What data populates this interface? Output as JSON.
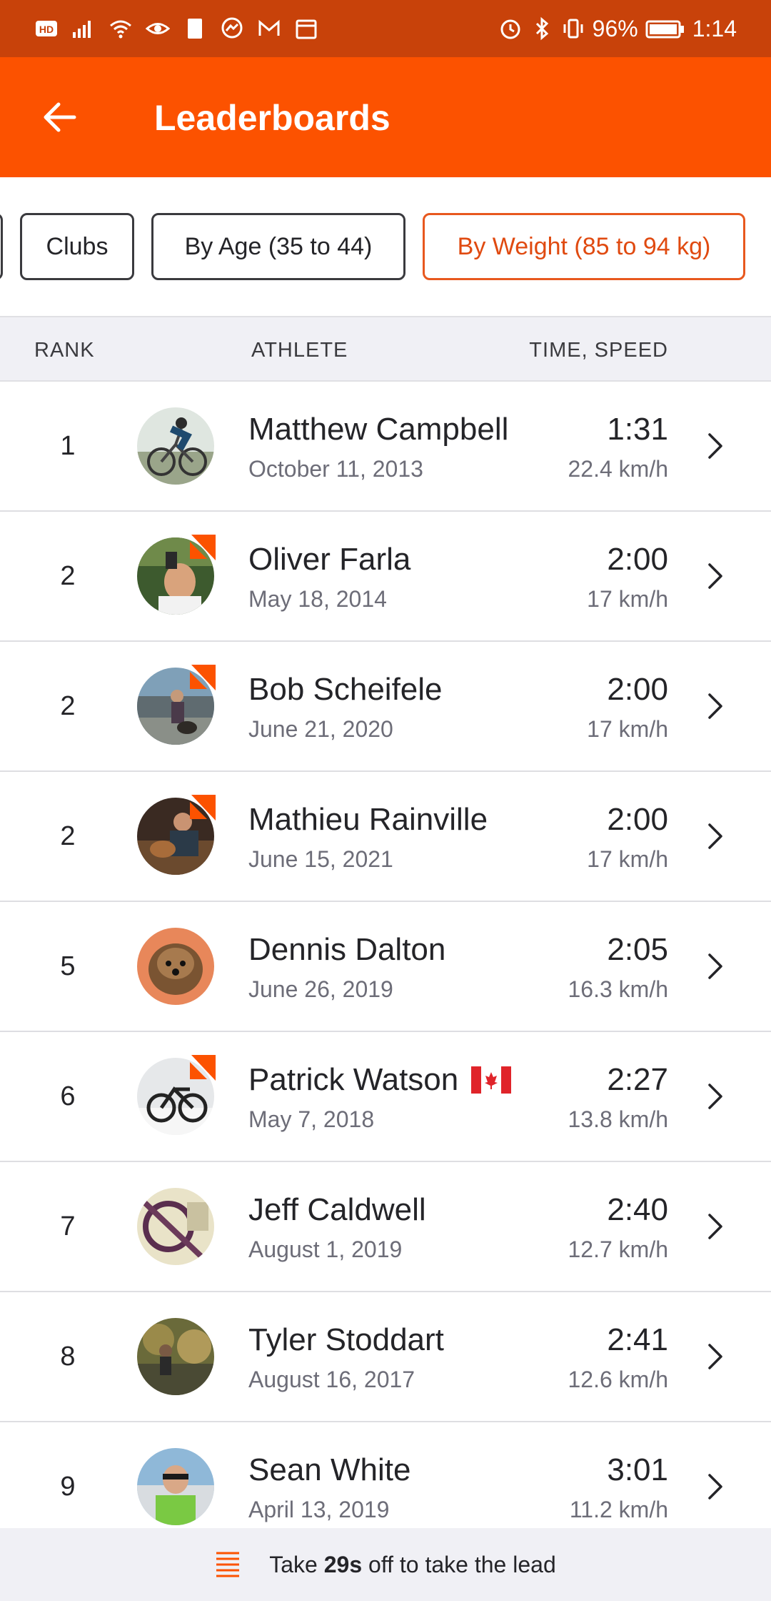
{
  "status_bar": {
    "battery": "96%",
    "time": "1:14",
    "left_icons": [
      "hd-icon",
      "signal-icon",
      "wifi-icon",
      "eye-icon",
      "sim-icon",
      "messenger-icon",
      "gmail-icon",
      "calendar-icon"
    ],
    "right_icons": [
      "alarm-icon",
      "bluetooth-icon",
      "vibrate-icon",
      "battery-icon"
    ]
  },
  "app_bar": {
    "title": "Leaderboards",
    "back_icon": "arrow-left-icon"
  },
  "filters": {
    "chips": [
      {
        "label": "Clubs",
        "active": false
      },
      {
        "label": "By Age (35 to 44)",
        "active": false
      },
      {
        "label": "By Weight (85 to 94 kg)",
        "active": true
      }
    ]
  },
  "table": {
    "headers": {
      "rank": "RANK",
      "athlete": "ATHLETE",
      "time_speed": "TIME, SPEED"
    },
    "rows": [
      {
        "rank": "1",
        "name": "Matthew Campbell",
        "date": "October 11, 2013",
        "time": "1:31",
        "speed": "22.4 km/h",
        "badge": false,
        "flag": false
      },
      {
        "rank": "2",
        "name": "Oliver Farla",
        "date": "May 18, 2014",
        "time": "2:00",
        "speed": "17 km/h",
        "badge": true,
        "flag": false
      },
      {
        "rank": "2",
        "name": "Bob Scheifele",
        "date": "June 21, 2020",
        "time": "2:00",
        "speed": "17 km/h",
        "badge": true,
        "flag": false
      },
      {
        "rank": "2",
        "name": "Mathieu Rainville",
        "date": "June 15, 2021",
        "time": "2:00",
        "speed": "17 km/h",
        "badge": true,
        "flag": false
      },
      {
        "rank": "5",
        "name": "Dennis Dalton",
        "date": "June 26, 2019",
        "time": "2:05",
        "speed": "16.3 km/h",
        "badge": false,
        "flag": false
      },
      {
        "rank": "6",
        "name": "Patrick Watson",
        "date": "May 7, 2018",
        "time": "2:27",
        "speed": "13.8 km/h",
        "badge": true,
        "flag": true
      },
      {
        "rank": "7",
        "name": "Jeff Caldwell",
        "date": "August 1, 2019",
        "time": "2:40",
        "speed": "12.7 km/h",
        "badge": false,
        "flag": false
      },
      {
        "rank": "8",
        "name": "Tyler Stoddart",
        "date": "August 16, 2017",
        "time": "2:41",
        "speed": "12.6 km/h",
        "badge": false,
        "flag": false
      },
      {
        "rank": "9",
        "name": "Sean White",
        "date": "April 13, 2019",
        "time": "3:01",
        "speed": "11.2 km/h",
        "badge": false,
        "flag": false
      }
    ]
  },
  "banner": {
    "prefix": "Take ",
    "amount": "29s",
    "suffix": " off to take the lead",
    "icon": "list-lines-icon"
  },
  "colors": {
    "brand": "#fc5200",
    "status_bar": "#c8420a",
    "active_chip": "#e8581e"
  }
}
